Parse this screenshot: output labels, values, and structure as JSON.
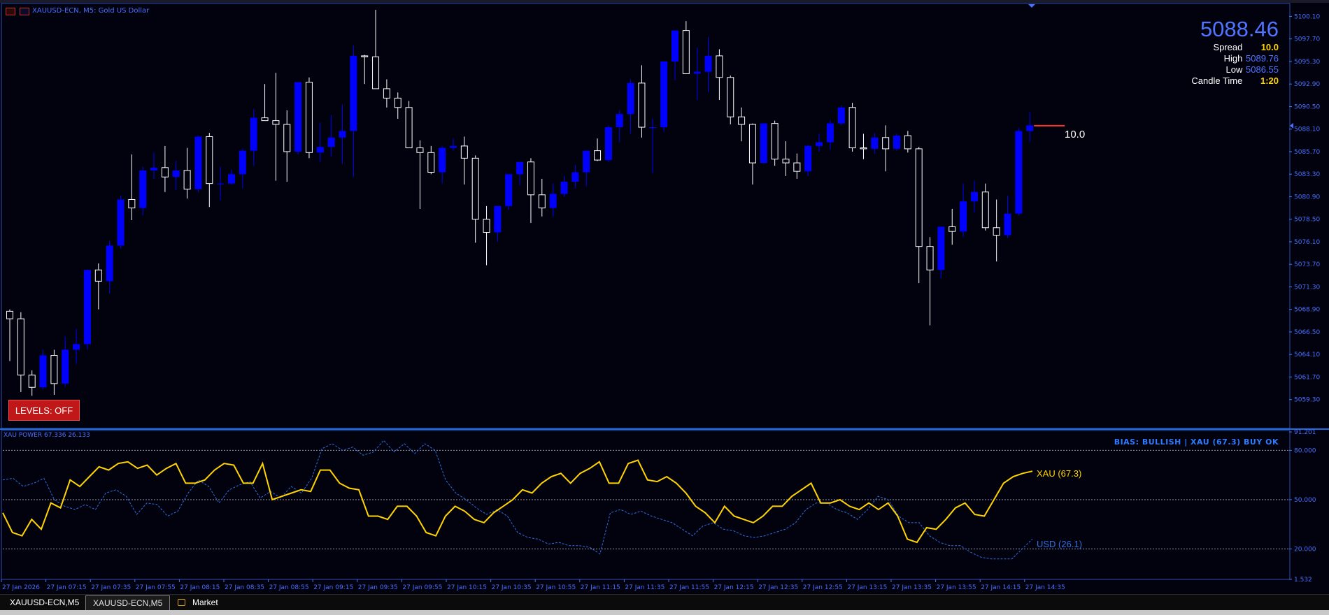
{
  "window": {
    "symbol_title": "XAUUSD-ECN, M5:  Gold US Dollar",
    "subwindow_title": "XAU POWER 67.336 26.133"
  },
  "info_panel": {
    "price": "5088.46",
    "rows": [
      {
        "label": "Spread",
        "value": "10.0",
        "color": "yellow"
      },
      {
        "label": "High",
        "value": "5089.76",
        "color": "blue"
      },
      {
        "label": "Low",
        "value": "5086.55",
        "color": "blue"
      },
      {
        "label": "Candle Time",
        "value": "1:20",
        "color": "yellow"
      }
    ]
  },
  "levels_button": "LEVELS: OFF",
  "spread_label": "10.0",
  "bias_text": "BIAS: BULLISH  |  XAU (67.3) BUY OK",
  "xau_label": "XAU (67.3)",
  "usd_label": "USD (26.1)",
  "tabs": [
    {
      "label": "XAUUSD-ECN,M5"
    },
    {
      "label": "XAUUSD-ECN,M5"
    },
    {
      "label": "Market"
    }
  ],
  "colors": {
    "background": "#02020f",
    "bull": "#0000ff",
    "bear": "#ffffff",
    "axis_text": "#4a70ff",
    "xau_line": "#ffd400",
    "usd_line": "#2f6fe0",
    "levels_bg": "#c01818"
  },
  "chart_data": [
    {
      "type": "candlestick",
      "ylim": [
        5056.3,
        5101.4
      ],
      "yticks": [
        "5100.10",
        "5097.70",
        "5095.30",
        "5092.90",
        "5090.50",
        "5088.10",
        "5085.70",
        "5083.30",
        "5080.90",
        "5078.50",
        "5076.10",
        "5073.70",
        "5071.30",
        "5068.90",
        "5066.50",
        "5064.10",
        "5061.70",
        "5059.30"
      ],
      "time_labels": [
        "27 Jan 2026",
        "27 Jan 07:15",
        "27 Jan 07:35",
        "27 Jan 07:55",
        "27 Jan 08:15",
        "27 Jan 08:35",
        "27 Jan 08:55",
        "27 Jan 09:15",
        "27 Jan 09:35",
        "27 Jan 09:55",
        "27 Jan 10:15",
        "27 Jan 10:35",
        "27 Jan 10:55",
        "27 Jan 11:15",
        "27 Jan 11:35",
        "27 Jan 11:55",
        "27 Jan 12:15",
        "27 Jan 12:35",
        "27 Jan 12:55",
        "27 Jan 13:15",
        "27 Jan 13:35",
        "27 Jan 13:55",
        "27 Jan 14:15",
        "27 Jan 14:35"
      ],
      "candles": [
        [
          5068.7,
          5068.9,
          5063.4,
          5067.9
        ],
        [
          5067.9,
          5068.6,
          5060.1,
          5061.9
        ],
        [
          5061.9,
          5062.4,
          5059.7,
          5060.6
        ],
        [
          5060.6,
          5064.6,
          5060.4,
          5064.0
        ],
        [
          5064.0,
          5064.6,
          5059.8,
          5061.0
        ],
        [
          5061.0,
          5066.0,
          5060.7,
          5064.6
        ],
        [
          5064.6,
          5066.8,
          5063.1,
          5065.2
        ],
        [
          5065.2,
          5073.1,
          5064.6,
          5073.1
        ],
        [
          5073.1,
          5073.8,
          5068.9,
          5071.9
        ],
        [
          5071.9,
          5076.2,
          5070.6,
          5075.7
        ],
        [
          5075.7,
          5081.0,
          5075.4,
          5080.6
        ],
        [
          5080.6,
          5085.4,
          5078.4,
          5079.7
        ],
        [
          5079.7,
          5084.1,
          5078.9,
          5083.7
        ],
        [
          5083.7,
          5085.6,
          5082.8,
          5084.0
        ],
        [
          5084.0,
          5086.3,
          5081.4,
          5083.0
        ],
        [
          5083.0,
          5084.7,
          5081.6,
          5083.7
        ],
        [
          5083.7,
          5086.1,
          5080.7,
          5081.7
        ],
        [
          5081.7,
          5087.4,
          5081.4,
          5087.3
        ],
        [
          5087.3,
          5087.7,
          5079.8,
          5082.3
        ],
        [
          5082.3,
          5084.1,
          5080.5,
          5082.3
        ],
        [
          5082.3,
          5083.8,
          5082.2,
          5083.3
        ],
        [
          5083.3,
          5086.0,
          5081.8,
          5085.8
        ],
        [
          5085.8,
          5090.2,
          5084.2,
          5089.3
        ],
        [
          5089.3,
          5092.9,
          5089.0,
          5089.0
        ],
        [
          5089.0,
          5094.1,
          5082.6,
          5088.6
        ],
        [
          5088.6,
          5090.1,
          5082.5,
          5085.7
        ],
        [
          5085.7,
          5093.1,
          5085.4,
          5093.1
        ],
        [
          5093.1,
          5093.6,
          5085.0,
          5085.6
        ],
        [
          5085.6,
          5088.8,
          5084.6,
          5086.2
        ],
        [
          5086.2,
          5089.6,
          5085.2,
          5087.2
        ],
        [
          5087.2,
          5090.7,
          5084.4,
          5087.9
        ],
        [
          5087.9,
          5097.0,
          5083.0,
          5095.9
        ],
        [
          5095.9,
          5096.0,
          5092.9,
          5095.8
        ],
        [
          5095.8,
          5100.8,
          5092.4,
          5092.4
        ],
        [
          5092.4,
          5093.4,
          5090.4,
          5091.4
        ],
        [
          5091.4,
          5092.0,
          5089.2,
          5090.4
        ],
        [
          5090.4,
          5091.1,
          5087.1,
          5086.1
        ],
        [
          5086.1,
          5086.9,
          5079.6,
          5085.6
        ],
        [
          5085.6,
          5086.3,
          5083.3,
          5083.5
        ],
        [
          5083.5,
          5086.3,
          5082.3,
          5086.1
        ],
        [
          5086.1,
          5087.1,
          5085.8,
          5086.3
        ],
        [
          5086.3,
          5087.3,
          5082.2,
          5085.0
        ],
        [
          5085.0,
          5085.3,
          5076.0,
          5078.5
        ],
        [
          5078.5,
          5079.9,
          5073.6,
          5077.1
        ],
        [
          5077.1,
          5079.5,
          5076.1,
          5079.9
        ],
        [
          5079.9,
          5083.2,
          5079.5,
          5083.3
        ],
        [
          5083.3,
          5084.3,
          5082.1,
          5084.6
        ],
        [
          5084.6,
          5085.0,
          5078.1,
          5081.1
        ],
        [
          5081.1,
          5082.8,
          5078.8,
          5079.7
        ],
        [
          5079.7,
          5082.3,
          5078.8,
          5081.2
        ],
        [
          5081.2,
          5083.1,
          5080.9,
          5082.5
        ],
        [
          5082.5,
          5084.3,
          5081.8,
          5083.5
        ],
        [
          5083.5,
          5085.8,
          5082.0,
          5085.8
        ],
        [
          5085.8,
          5087.1,
          5084.7,
          5084.8
        ],
        [
          5084.8,
          5088.5,
          5084.6,
          5088.3
        ],
        [
          5088.3,
          5090.1,
          5086.7,
          5089.7
        ],
        [
          5089.7,
          5093.4,
          5087.6,
          5093.0
        ],
        [
          5093.0,
          5094.9,
          5087.2,
          5088.3
        ],
        [
          5088.3,
          5089.2,
          5083.4,
          5088.3
        ],
        [
          5088.3,
          5095.3,
          5087.8,
          5095.3
        ],
        [
          5095.3,
          5097.9,
          5093.3,
          5098.6
        ],
        [
          5098.6,
          5099.6,
          5094.0,
          5094.0
        ],
        [
          5094.0,
          5096.8,
          5091.2,
          5094.2
        ],
        [
          5094.2,
          5097.9,
          5092.0,
          5095.9
        ],
        [
          5095.9,
          5096.6,
          5091.2,
          5093.6
        ],
        [
          5093.6,
          5093.8,
          5088.6,
          5089.4
        ],
        [
          5089.4,
          5090.4,
          5086.8,
          5088.6
        ],
        [
          5088.6,
          5088.7,
          5082.2,
          5084.5
        ],
        [
          5084.5,
          5088.7,
          5084.4,
          5088.7
        ],
        [
          5088.7,
          5089.0,
          5084.2,
          5084.9
        ],
        [
          5084.9,
          5086.8,
          5083.1,
          5084.5
        ],
        [
          5084.5,
          5085.5,
          5082.8,
          5083.6
        ],
        [
          5083.6,
          5086.4,
          5083.1,
          5086.3
        ],
        [
          5086.3,
          5087.6,
          5085.7,
          5086.7
        ],
        [
          5086.7,
          5089.0,
          5085.9,
          5088.7
        ],
        [
          5088.7,
          5090.6,
          5088.5,
          5090.4
        ],
        [
          5090.4,
          5090.9,
          5085.7,
          5086.1
        ],
        [
          5086.1,
          5087.6,
          5084.9,
          5086.0
        ],
        [
          5086.0,
          5087.7,
          5085.5,
          5087.2
        ],
        [
          5087.2,
          5088.5,
          5083.6,
          5086.0
        ],
        [
          5086.0,
          5087.6,
          5085.8,
          5087.4
        ],
        [
          5087.4,
          5087.9,
          5085.6,
          5086.0
        ],
        [
          5086.0,
          5086.2,
          5071.7,
          5075.6
        ],
        [
          5075.6,
          5076.6,
          5067.2,
          5073.1
        ],
        [
          5073.1,
          5077.5,
          5072.2,
          5077.7
        ],
        [
          5077.7,
          5079.6,
          5075.8,
          5077.2
        ],
        [
          5077.2,
          5082.3,
          5076.6,
          5080.4
        ],
        [
          5080.4,
          5082.6,
          5079.2,
          5081.4
        ],
        [
          5081.4,
          5082.3,
          5077.3,
          5077.6
        ],
        [
          5077.6,
          5080.6,
          5074.0,
          5076.8
        ],
        [
          5076.8,
          5081.0,
          5076.5,
          5079.1
        ],
        [
          5079.1,
          5088.2,
          5078.9,
          5087.9
        ],
        [
          5087.9,
          5089.9,
          5086.7,
          5088.5
        ]
      ],
      "current_price": 5088.46
    },
    {
      "type": "line",
      "title": "XAU POWER 67.336 26.133",
      "ylim": [
        1.532,
        91.201
      ],
      "yticks": [
        "91.201",
        "80.000",
        "50.000",
        "20.000",
        "1.532"
      ],
      "levels": [
        80,
        50,
        20
      ],
      "series": [
        {
          "name": "XAU (67.3)",
          "values": [
            42,
            30,
            28,
            38,
            32,
            48,
            45,
            62,
            58,
            64,
            70,
            68,
            72,
            73,
            69,
            71,
            65,
            69,
            72,
            60,
            60,
            62,
            68,
            72,
            71,
            60,
            60,
            72,
            50,
            52,
            54,
            56,
            55,
            68,
            68,
            60,
            57,
            56,
            40,
            40,
            38,
            46,
            46,
            40,
            30,
            28,
            40,
            46,
            43,
            38,
            36,
            42,
            46,
            50,
            56,
            54,
            60,
            64,
            66,
            60,
            66,
            69,
            73,
            60,
            60,
            72,
            74,
            62,
            61,
            64,
            60,
            54,
            46,
            42,
            36,
            46,
            40,
            38,
            36,
            40,
            46,
            46,
            52,
            56,
            60,
            48,
            48,
            50,
            46,
            44,
            48,
            44,
            48,
            40,
            26,
            24,
            33,
            32,
            38,
            45,
            48,
            41,
            40,
            50,
            60,
            64,
            66,
            67.3
          ]
        },
        {
          "name": "USD (26.1)",
          "values": [
            62,
            63,
            58,
            60,
            63,
            50,
            46,
            44,
            47,
            44,
            54,
            56,
            52,
            41,
            48,
            47,
            40,
            43,
            54,
            62,
            58,
            48,
            56,
            59,
            61,
            51,
            55,
            51,
            58,
            54,
            63,
            81,
            84,
            80,
            82,
            77,
            79,
            86,
            79,
            84,
            78,
            84,
            80,
            62,
            54,
            50,
            45,
            41,
            44,
            40,
            30,
            27,
            26,
            23,
            24,
            22,
            22,
            21,
            17,
            42,
            44,
            41,
            43,
            40,
            38,
            36,
            32,
            28,
            34,
            36,
            32,
            31,
            28,
            27,
            28,
            30,
            32,
            36,
            44,
            48,
            48,
            44,
            42,
            38,
            44,
            52,
            50,
            40,
            36,
            36,
            28,
            24,
            22,
            22,
            18,
            15,
            14,
            14,
            14,
            20,
            26.1
          ]
        }
      ]
    }
  ]
}
